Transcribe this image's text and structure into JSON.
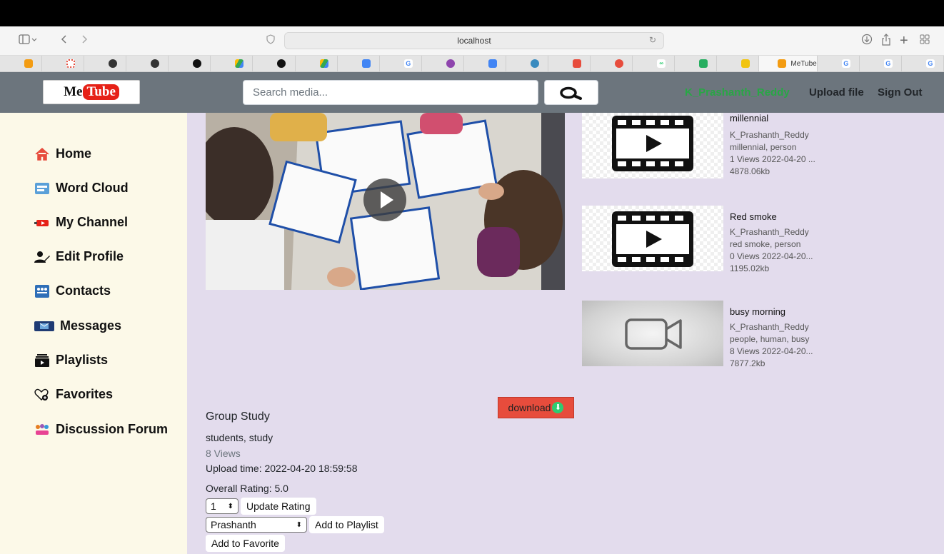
{
  "browser": {
    "url": "localhost",
    "active_tab_title": "MeTube"
  },
  "header": {
    "logo_me": "Me",
    "logo_tube": "Tube",
    "search_placeholder": "Search media...",
    "username": "K_Prashanth_Reddy",
    "upload_label": "Upload file",
    "signout_label": "Sign Out"
  },
  "sidebar": {
    "items": [
      {
        "label": "Home",
        "icon": "home-icon"
      },
      {
        "label": "Word Cloud",
        "icon": "word-cloud-icon"
      },
      {
        "label": "My Channel",
        "icon": "youtube-icon"
      },
      {
        "label": "Edit Profile",
        "icon": "edit-profile-icon"
      },
      {
        "label": "Contacts",
        "icon": "contacts-icon"
      },
      {
        "label": "Messages",
        "icon": "messages-icon"
      },
      {
        "label": "Playlists",
        "icon": "playlists-icon"
      },
      {
        "label": "Favorites",
        "icon": "favorites-icon"
      },
      {
        "label": "Discussion Forum",
        "icon": "forum-icon"
      }
    ]
  },
  "video": {
    "title": "Group Study",
    "tags": "students, study",
    "views": "8 Views",
    "upload_time": "Upload time: 2022-04-20 18:59:58",
    "rating": "Overall Rating: 5.0",
    "download_label": "download"
  },
  "controls": {
    "rating_value": "1",
    "update_rating_label": "Update Rating",
    "playlist_value": "Prashanth",
    "add_playlist_label": "Add to Playlist",
    "add_favorite_label": "Add to Favorite"
  },
  "recommendations": [
    {
      "title": "millennial",
      "author": "K_Prashanth_Reddy",
      "tags": "millennial, person",
      "meta": "1 Views 2022-04-20 ...",
      "size": "4878.06kb",
      "thumb": "film-icon"
    },
    {
      "title": "Red smoke",
      "author": "K_Prashanth_Reddy",
      "tags": "red smoke, person",
      "meta": "0 Views 2022-04-20...",
      "size": "1195.02kb",
      "thumb": "film-icon"
    },
    {
      "title": "busy morning",
      "author": "K_Prashanth_Reddy",
      "tags": "people, human, busy",
      "meta": "8 Views 2022-04-20...",
      "size": "7877.2kb",
      "thumb": "video-camera-icon"
    }
  ],
  "colors": {
    "header_bg": "#6c757d",
    "sidebar_bg": "#fcf9e8",
    "main_bg": "#e3dced",
    "username": "#28a745",
    "download_bg": "#e74c3c"
  }
}
